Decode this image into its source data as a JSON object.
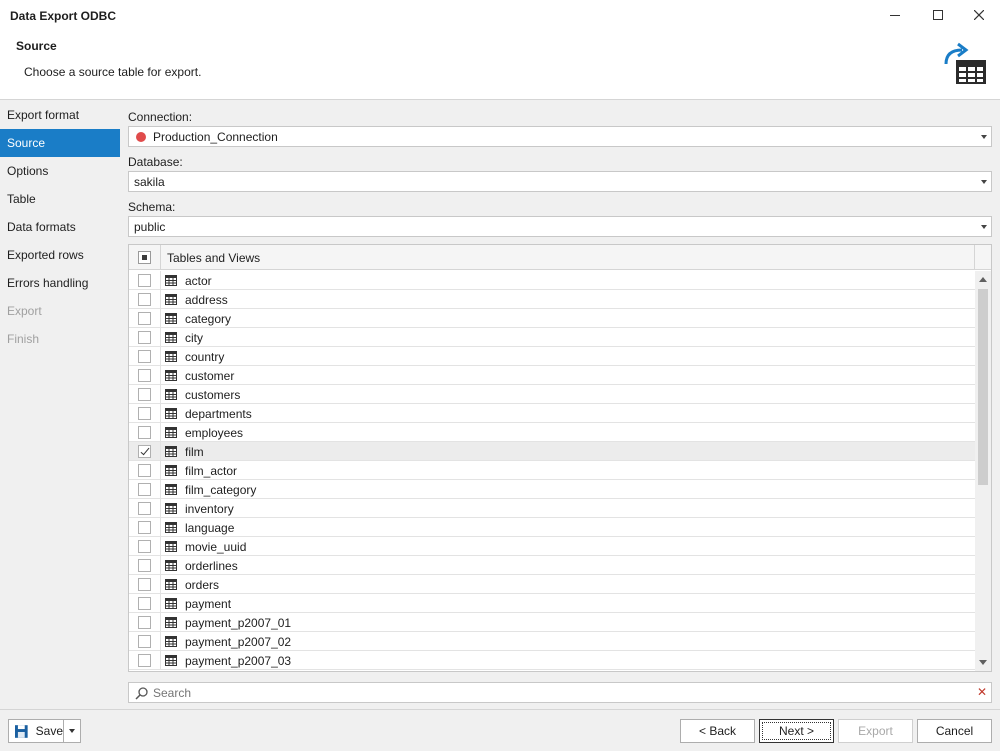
{
  "window": {
    "title": "Data Export ODBC"
  },
  "header": {
    "title": "Source",
    "subtitle": "Choose a source table for export."
  },
  "sidebar": {
    "items": [
      {
        "label": "Export format",
        "state": "normal"
      },
      {
        "label": "Source",
        "state": "active"
      },
      {
        "label": "Options",
        "state": "normal"
      },
      {
        "label": "Table",
        "state": "normal"
      },
      {
        "label": "Data formats",
        "state": "normal"
      },
      {
        "label": "Exported rows",
        "state": "normal"
      },
      {
        "label": "Errors handling",
        "state": "normal"
      },
      {
        "label": "Export",
        "state": "disabled"
      },
      {
        "label": "Finish",
        "state": "disabled"
      }
    ]
  },
  "connection": {
    "label": "Connection:",
    "value": "Production_Connection",
    "status_color": "#e04b4b"
  },
  "database": {
    "label": "Database:",
    "value": "sakila"
  },
  "schema": {
    "label": "Schema:",
    "value": "public"
  },
  "tables": {
    "header": "Tables and Views",
    "rows": [
      {
        "name": "actor",
        "checked": false
      },
      {
        "name": "address",
        "checked": false
      },
      {
        "name": "category",
        "checked": false
      },
      {
        "name": "city",
        "checked": false
      },
      {
        "name": "country",
        "checked": false
      },
      {
        "name": "customer",
        "checked": false
      },
      {
        "name": "customers",
        "checked": false
      },
      {
        "name": "departments",
        "checked": false
      },
      {
        "name": "employees",
        "checked": false
      },
      {
        "name": "film",
        "checked": true
      },
      {
        "name": "film_actor",
        "checked": false
      },
      {
        "name": "film_category",
        "checked": false
      },
      {
        "name": "inventory",
        "checked": false
      },
      {
        "name": "language",
        "checked": false
      },
      {
        "name": "movie_uuid",
        "checked": false
      },
      {
        "name": "orderlines",
        "checked": false
      },
      {
        "name": "orders",
        "checked": false
      },
      {
        "name": "payment",
        "checked": false
      },
      {
        "name": "payment_p2007_01",
        "checked": false
      },
      {
        "name": "payment_p2007_02",
        "checked": false
      },
      {
        "name": "payment_p2007_03",
        "checked": false
      }
    ]
  },
  "search": {
    "placeholder": "Search"
  },
  "footer": {
    "save_label": "Save",
    "back_label": "< Back",
    "next_label": "Next >",
    "export_label": "Export",
    "cancel_label": "Cancel"
  },
  "colors": {
    "accent": "#1a7dc7",
    "icon_blue": "#1a7dc7"
  }
}
